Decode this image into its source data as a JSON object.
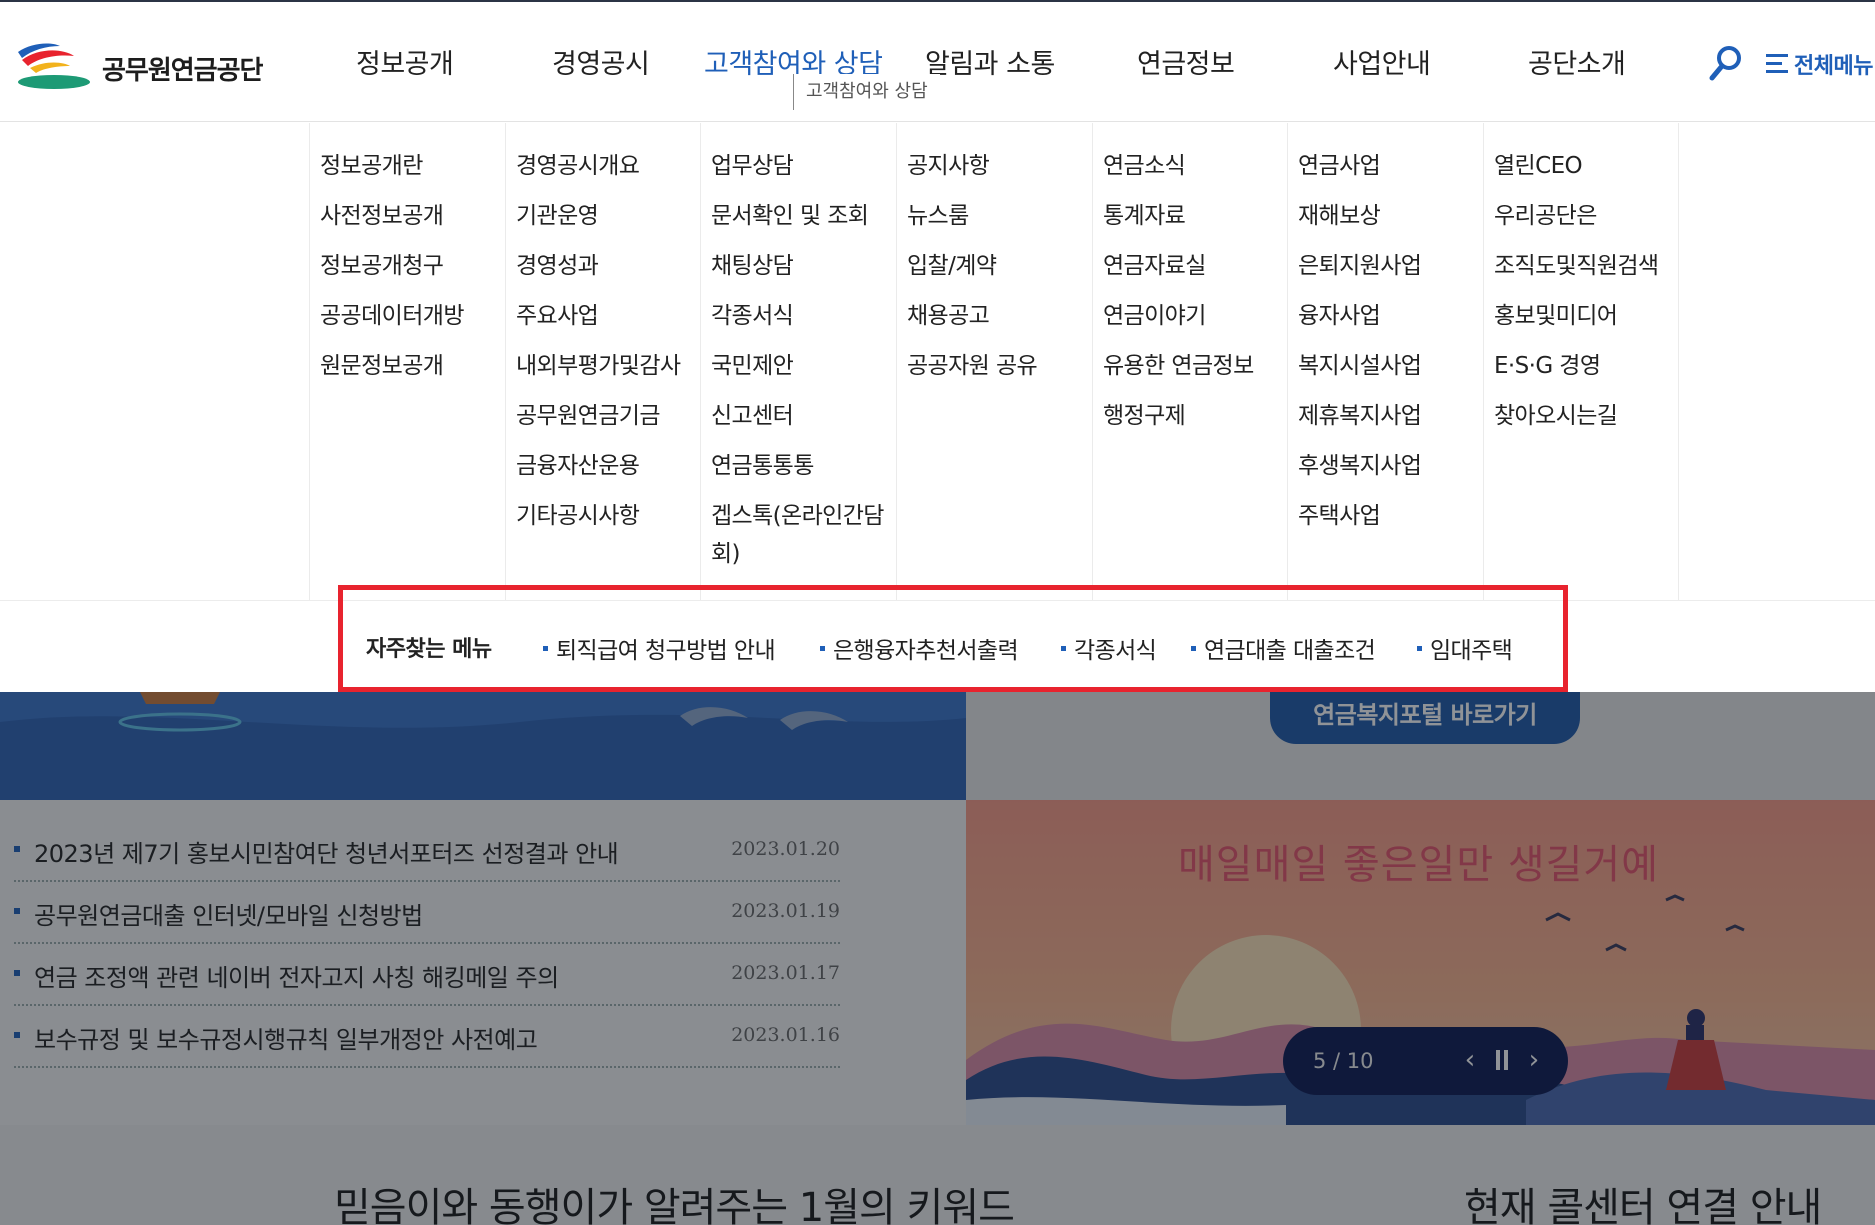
{
  "header": {
    "logo_text": "공무원연금공단",
    "gnb": [
      {
        "label": "정보공개",
        "active": false
      },
      {
        "label": "경영공시",
        "active": false
      },
      {
        "label": "고객참여와 상담",
        "active": true
      },
      {
        "label": "알림과 소통",
        "active": false
      },
      {
        "label": "연금정보",
        "active": false
      },
      {
        "label": "사업안내",
        "active": false
      },
      {
        "label": "공단소개",
        "active": false
      }
    ],
    "tooltip": "고객참여와 상담",
    "search_icon": "search-icon",
    "allmenu_label": "전체메뉴",
    "accent_color": "#1f5fb8"
  },
  "mega_menu": {
    "columns": [
      {
        "items": [
          "정보공개란",
          "사전정보공개",
          "정보공개청구",
          "공공데이터개방",
          "원문정보공개"
        ]
      },
      {
        "items": [
          "경영공시개요",
          "기관운영",
          "경영성과",
          "주요사업",
          "내외부평가및감사",
          "공무원연금기금",
          "금융자산운용",
          "기타공시사항"
        ]
      },
      {
        "items": [
          "업무상담",
          "문서확인 및 조회",
          "채팅상담",
          "각종서식",
          "국민제안",
          "신고센터",
          "연금통통통",
          "겝스톡(온라인간담회)"
        ]
      },
      {
        "items": [
          "공지사항",
          "뉴스룸",
          "입찰/계약",
          "채용공고",
          "공공자원 공유"
        ]
      },
      {
        "items": [
          "연금소식",
          "통계자료",
          "연금자료실",
          "연금이야기",
          "유용한 연금정보",
          "행정구제"
        ]
      },
      {
        "items": [
          "연금사업",
          "재해보상",
          "은퇴지원사업",
          "융자사업",
          "복지시설사업",
          "제휴복지사업",
          "후생복지사업",
          "주택사업"
        ]
      },
      {
        "items": [
          "열린CEO",
          "우리공단은",
          "조직도및직원검색",
          "홍보및미디어",
          "E·S·G 경영",
          "찾아오시는길"
        ]
      }
    ]
  },
  "quick_menu": {
    "title": "자주찾는 메뉴",
    "items": [
      "퇴직급여 청구방법 안내",
      "은행융자추천서출력",
      "각종서식",
      "연금대출 대출조건",
      "임대주택"
    ],
    "highlight_color": "#e8232e"
  },
  "main": {
    "welfare_button": "연금복지포털 바로가기",
    "notices": [
      {
        "title": "2023년 제7기 홍보시민참여단 청년서포터즈 선정결과 안내",
        "date": "2023.01.20"
      },
      {
        "title": "공무원연금대출 인터넷/모바일 신청방법",
        "date": "2023.01.19"
      },
      {
        "title": "연금 조정액 관련 네이버 전자고지 사칭 해킹메일 주의",
        "date": "2023.01.17"
      },
      {
        "title": "보수규정 및 보수규정시행규칙 일부개정안 사전예고",
        "date": "2023.01.16"
      }
    ],
    "banner_text": "매일매일 좋은일만 생길거예",
    "pager": {
      "count": "5 / 10",
      "prev_icon": "chevron-left-icon",
      "pause_icon": "pause-icon",
      "next_icon": "chevron-right-icon"
    },
    "bottom_left_title": "믿음이와 동행이가 알려주는 1월의 키워드",
    "bottom_right_title": "현재 콜센터 연결 안내"
  }
}
